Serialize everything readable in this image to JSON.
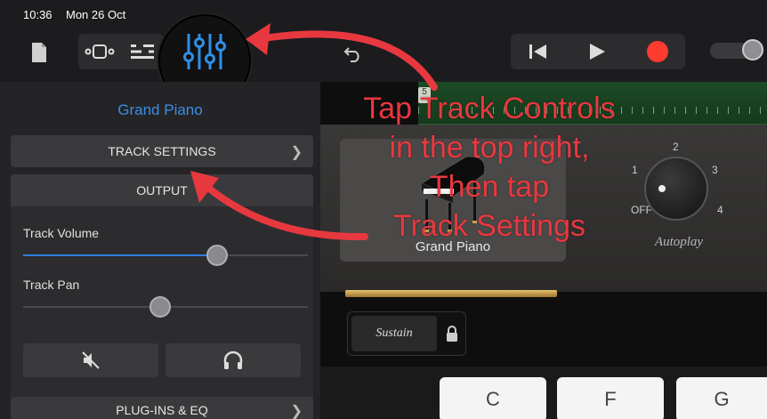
{
  "status_bar": {
    "time": "10:36",
    "date": "Mon 26 Oct"
  },
  "toolbar": {
    "icons": [
      "document-icon",
      "browser-view-icon",
      "tracks-view-icon",
      "track-controls-icon",
      "undo-icon",
      "rewind-icon",
      "play-icon",
      "record-icon"
    ],
    "accent_color": "#2f8fe6",
    "record_color": "#ff3b30"
  },
  "left_panel": {
    "title": "Grand Piano",
    "track_settings_label": "TRACK SETTINGS",
    "output_label": "OUTPUT",
    "track_volume_label": "Track Volume",
    "track_volume_value": 0.68,
    "track_pan_label": "Track Pan",
    "track_pan_value": 0.48,
    "plugins_label": "PLUG-INS & EQ"
  },
  "main": {
    "ruler_marker": "5",
    "instrument_name": "Grand Piano",
    "autoplay_label": "Autoplay",
    "autoplay_levels": [
      "OFF",
      "1",
      "2",
      "3",
      "4"
    ],
    "autoplay_selected": "OFF",
    "sustain_label": "Sustain",
    "keys": [
      "C",
      "F",
      "G"
    ]
  },
  "annotation": {
    "lines": [
      "Tap Track Controls",
      "in the top right,",
      "Then tap",
      "Track Settings"
    ],
    "color": "#e8383f"
  }
}
